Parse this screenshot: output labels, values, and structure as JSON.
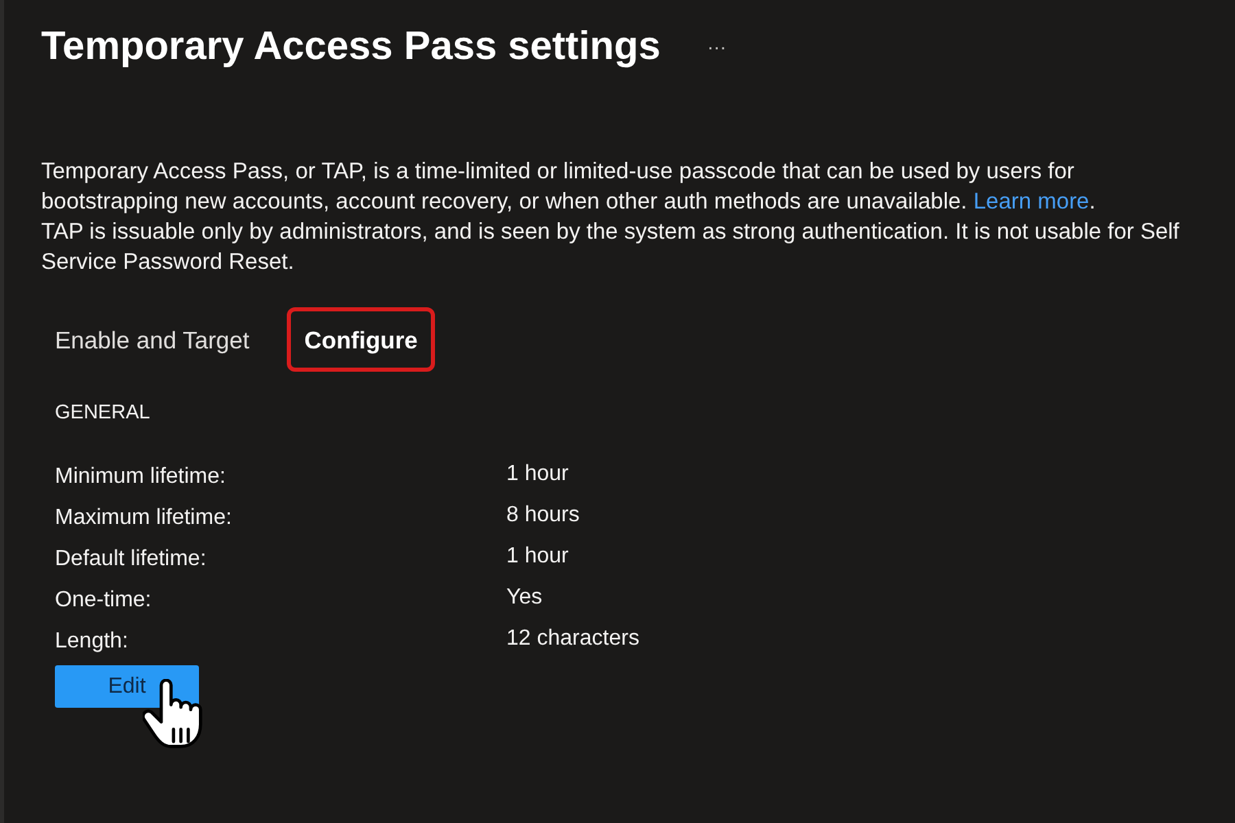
{
  "page": {
    "title": "Temporary Access Pass settings",
    "more_button": "···"
  },
  "description": {
    "paragraphs": [
      {
        "text": "Temporary Access Pass, or TAP, is a time-limited or limited-use passcode that can be used by users for bootstrapping new accounts, account recovery, or when other auth methods are unavailable. ",
        "link": "Learn more",
        "after_link": "."
      },
      {
        "text": "TAP is issuable only by administrators, and is seen by the system as strong authentication. It is not usable for Self Service Password Reset."
      }
    ]
  },
  "tabs": [
    {
      "label": "Enable and Target",
      "selected": false,
      "highlighted": false
    },
    {
      "label": "Configure",
      "selected": true,
      "highlighted": true
    }
  ],
  "section": {
    "heading": "GENERAL",
    "settings": [
      {
        "label": "Minimum lifetime:",
        "value": "1 hour"
      },
      {
        "label": "Maximum lifetime:",
        "value": "8 hours"
      },
      {
        "label": "Default lifetime:",
        "value": "1 hour"
      },
      {
        "label": "One-time:",
        "value": "Yes"
      },
      {
        "label": "Length:",
        "value": "12 characters"
      }
    ]
  },
  "edit_button": {
    "label": "Edit"
  }
}
